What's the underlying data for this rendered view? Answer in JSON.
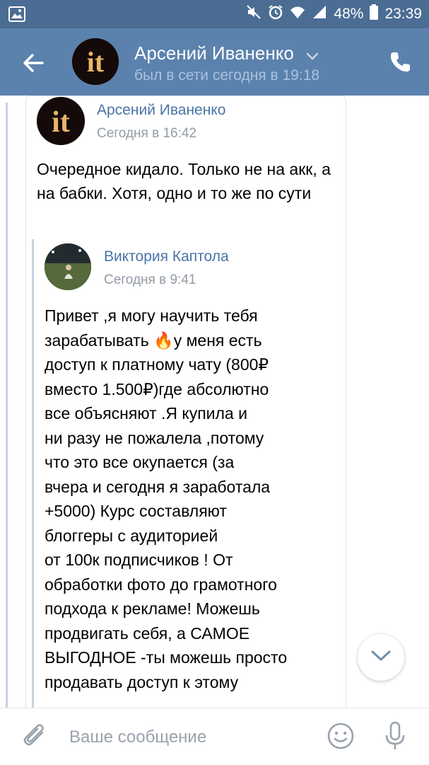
{
  "status_bar": {
    "battery": "48%",
    "time": "23:39"
  },
  "header": {
    "name": "Арсений Иваненко",
    "status": "был в сети сегодня в 19:18"
  },
  "message": {
    "sender": "Арсений Иваненко",
    "time": "Сегодня в 16:42",
    "text": "Очередное кидало. Только не на акк, а на бабки. Хотя, одно и то же по сути",
    "forwarded": {
      "sender": "Виктория Каптола",
      "time": "Сегодня в 9:41",
      "text": "Привет ,я могу научить тебя\nзарабатывать 🔥у меня есть\nдоступ к платному чату (800₽\nвместо 1.500₽)где абсолютно\nвсе объясняют .Я купила и\nни разу не пожалела ,потому\nчто это все окупается (за\nвчера и сегодня я заработала\n+5000) Курс составляют\nблоггеры с аудиторией\nот 100к подписчиков ! От\nобработки фото до грамотного\nподхода к рекламе! Можешь\nпродвигать себя, а САМОЕ\nВЫГОДНОЕ -ты можешь просто\nпродавать доступ к этому"
    }
  },
  "input": {
    "placeholder": "Ваше сообщение"
  },
  "icons": {
    "back": "back-arrow-icon",
    "phone": "phone-icon",
    "attach": "paperclip-icon",
    "emoji": "smile-icon",
    "mic": "microphone-icon",
    "scroll": "chevron-down-icon"
  },
  "colors": {
    "header": "#5b82ad",
    "status_bar": "#4b6d93",
    "link": "#4a74a6"
  }
}
